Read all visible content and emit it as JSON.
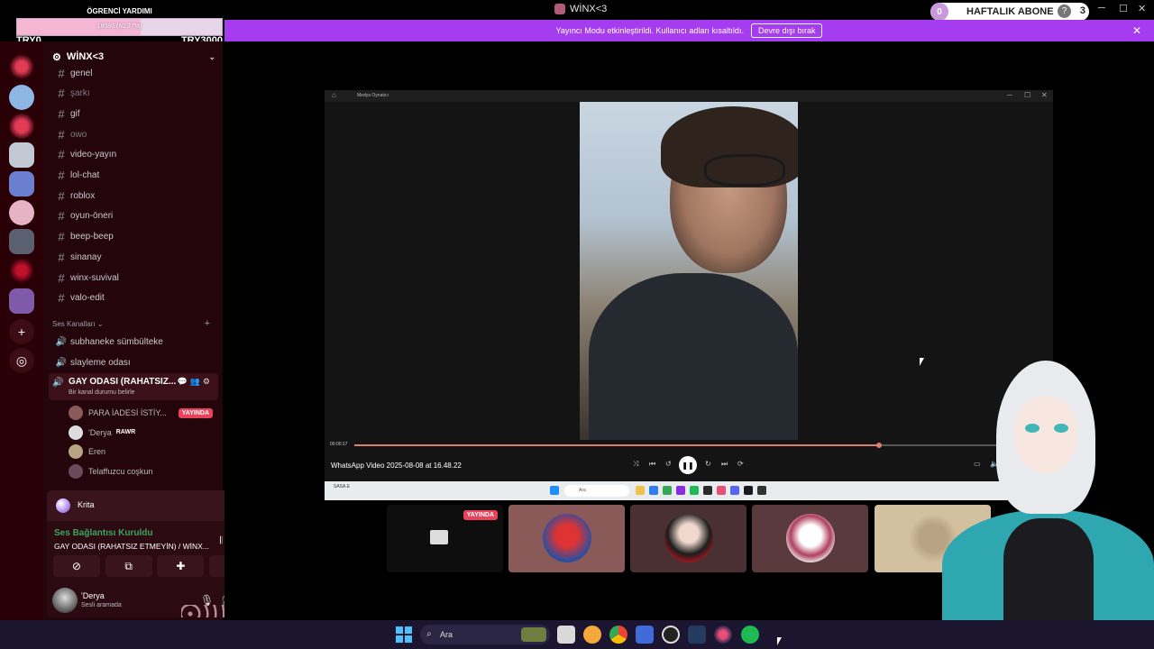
{
  "title_bar": {
    "server_name": "WİNX<3",
    "window_controls": [
      "minimize-icon",
      "maximize-icon",
      "close-icon"
    ]
  },
  "goal_widget": {
    "title": "ÖGRENCİ YARDIMI",
    "progress_text": "18086 (60.27%)",
    "progress_fraction": 0.6027,
    "min_label": "TRY0",
    "max_label": "TRY3000"
  },
  "sub_widget": {
    "count": "0",
    "label": "HAFTALIK ABONE",
    "help": "?",
    "number": "3"
  },
  "notice": {
    "text": "Yayıncı Modu etkinleştirildi. Kullanıcı adları kısaltıldı.",
    "button": "Devre dışı bırak"
  },
  "server": {
    "name": "WİNX<3",
    "text_channels": [
      {
        "name": "genel",
        "muted": false
      },
      {
        "name": "şarkı",
        "muted": true
      },
      {
        "name": "gif",
        "muted": false
      },
      {
        "name": "owo",
        "muted": true
      },
      {
        "name": "video-yayın",
        "muted": false
      },
      {
        "name": "lol-chat",
        "muted": false
      },
      {
        "name": "roblox",
        "muted": false
      },
      {
        "name": "oyun-öneri",
        "muted": false
      },
      {
        "name": "beep-beep",
        "muted": false
      },
      {
        "name": "sinanay",
        "muted": false
      },
      {
        "name": "winx-suvival",
        "muted": false
      },
      {
        "name": "valo-edit",
        "muted": false
      }
    ],
    "voice_category": "Ses Kanalları",
    "voice_channels": [
      "subhaneke sümbülteke",
      "slayleme odası"
    ],
    "active_voice": {
      "name": "GAY ODASI (RAHATSIZ...",
      "status": "Bir kanal durumu belirle"
    },
    "members": [
      {
        "name": "PARA İADESİ İSTİY...",
        "badge": "YAYINDA",
        "tag": ""
      },
      {
        "name": "'Derya",
        "badge": "",
        "tag": "RAWR"
      },
      {
        "name": "Eren",
        "badge": "",
        "tag": ""
      },
      {
        "name": "Telaffuzcu coşkun",
        "badge": "",
        "tag": ""
      }
    ]
  },
  "user_panel": {
    "activity": "Krita",
    "connection_status": "Ses Bağlantısı Kuruldu",
    "connection_channel": "GAY ODASI (RAHATSIZ ETMEYİN) / WİNX...",
    "username": "'Derya",
    "user_status": "Sesli aramada"
  },
  "media_player": {
    "app_title": "Medya Oynatıcı",
    "time": "00:00:17",
    "progress_fraction": 0.787,
    "file_name": "WhatsApp Video 2025-08-08 at 16.48.22",
    "search_placeholder": "Ara",
    "weather": "SASA.E"
  },
  "stream_tiles": {
    "live_label": "YAYINDA"
  },
  "taskbar": {
    "search_placeholder": "Ara"
  },
  "colors": {
    "accent": "#a63cf0",
    "live": "#e9425b",
    "connected": "#3ba55d"
  }
}
